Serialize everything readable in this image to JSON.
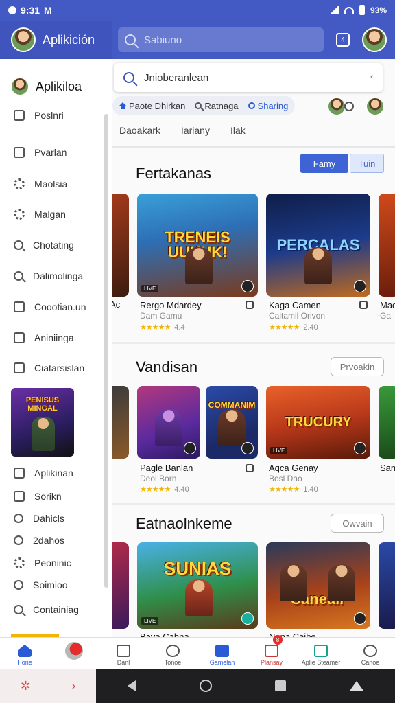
{
  "status_bar": {
    "time": "9:31",
    "indicator": "M",
    "right_text": "93%"
  },
  "header": {
    "app_title": "Aplikición",
    "search_placeholder": "Sabiuno"
  },
  "drawer": {
    "profile_name": "Aplikiloa",
    "items": [
      {
        "label": "Poslnri",
        "icon": "square-icon"
      },
      {
        "label": "Pvarlan",
        "icon": "arrow-box-icon"
      },
      {
        "label": "Maolsia",
        "icon": "gear-icon"
      },
      {
        "label": "Malgan",
        "icon": "gear-icon"
      },
      {
        "label": "Chotating",
        "icon": "search-icon"
      },
      {
        "label": "Dalimolinga",
        "icon": "search-icon"
      },
      {
        "label": "Coootian.un",
        "icon": "share-icon"
      },
      {
        "label": "Aniniinga",
        "icon": "square-icon"
      },
      {
        "label": "Ciatarsislan",
        "icon": "image-icon"
      }
    ],
    "items_lower": [
      {
        "label": "Aplikinan",
        "icon": "chart-icon"
      },
      {
        "label": "Sorikn",
        "icon": "square-icon"
      },
      {
        "label": "Dahicls",
        "icon": "circle-icon"
      },
      {
        "label": "2dahos",
        "icon": "circle-icon"
      },
      {
        "label": "Peoninic",
        "icon": "gear-icon"
      },
      {
        "label": "Soimioo",
        "icon": "circle-icon"
      },
      {
        "label": "Containiag",
        "icon": "search-icon"
      }
    ],
    "art_text": "PENISUS MINGAL"
  },
  "main": {
    "inner_search": "Jnioberanlean",
    "chips": [
      {
        "label": "Paote Dhirkan",
        "active": false
      },
      {
        "label": "Ratnaga",
        "active": false
      },
      {
        "label": "Sharing",
        "active": true
      }
    ],
    "subtabs": [
      "Daoakark",
      "Iariany",
      "Ilak"
    ],
    "section1": {
      "title": "Fertakanas",
      "btn_primary": "Famy",
      "btn_secondary": "Tuin",
      "cards": [
        {
          "art": "TRENEIS UUKUK!",
          "title": "Rergo Mdardey",
          "sub": "Dam Gamu",
          "rating": "4.4",
          "stars": "★★★★★"
        },
        {
          "art": "PERCALAS",
          "title": "Kaga Camen",
          "sub": "Caitamil Orivon",
          "rating": "2.40",
          "stars": "★★★★★"
        }
      ],
      "partial_left": {
        "title": "Ac",
        "sub": ""
      },
      "partial_right": {
        "title": "Mac",
        "sub": "Ga"
      }
    },
    "section2": {
      "title": "Vandisan",
      "btn": "Prvoakin",
      "cards": [
        {
          "art": "",
          "title": "Pagle Banlan",
          "sub": "Deol Born",
          "rating": "4.40",
          "stars": "★★★★★"
        },
        {
          "art": "COMMANIM",
          "title": "",
          "sub": "",
          "rating": "",
          "stars": ""
        },
        {
          "art": "TRUCURY",
          "title": "Aqca Genay",
          "sub": "Bosl Dao",
          "rating": "1.40",
          "stars": "★★★★★"
        }
      ],
      "partial_right": {
        "title": "San",
        "sub": ""
      }
    },
    "section3": {
      "title": "Eatnaolnkeme",
      "btn": "Owvain",
      "cards": [
        {
          "art": "SUNIAS",
          "title": "Bava Cahna"
        },
        {
          "art": "Sanealr",
          "title": "Nana Caibe"
        }
      ]
    }
  },
  "bottom_nav": [
    {
      "label": "Hone",
      "active": true,
      "badge": ""
    },
    {
      "label": "",
      "active": false,
      "badge": ""
    },
    {
      "label": "Danl",
      "active": false,
      "badge": ""
    },
    {
      "label": "Tonoe",
      "active": false,
      "badge": ""
    },
    {
      "label": "Gamelan",
      "active": true,
      "badge": ""
    },
    {
      "label": "Plansay",
      "active": false,
      "badge": "8"
    },
    {
      "label": "Aplie Steamer",
      "active": false,
      "badge": ""
    },
    {
      "label": "Canoe",
      "active": false,
      "badge": ""
    }
  ],
  "colors": {
    "accent": "#4359c4",
    "primary_button": "#3d63d4",
    "star": "#f2b400"
  }
}
